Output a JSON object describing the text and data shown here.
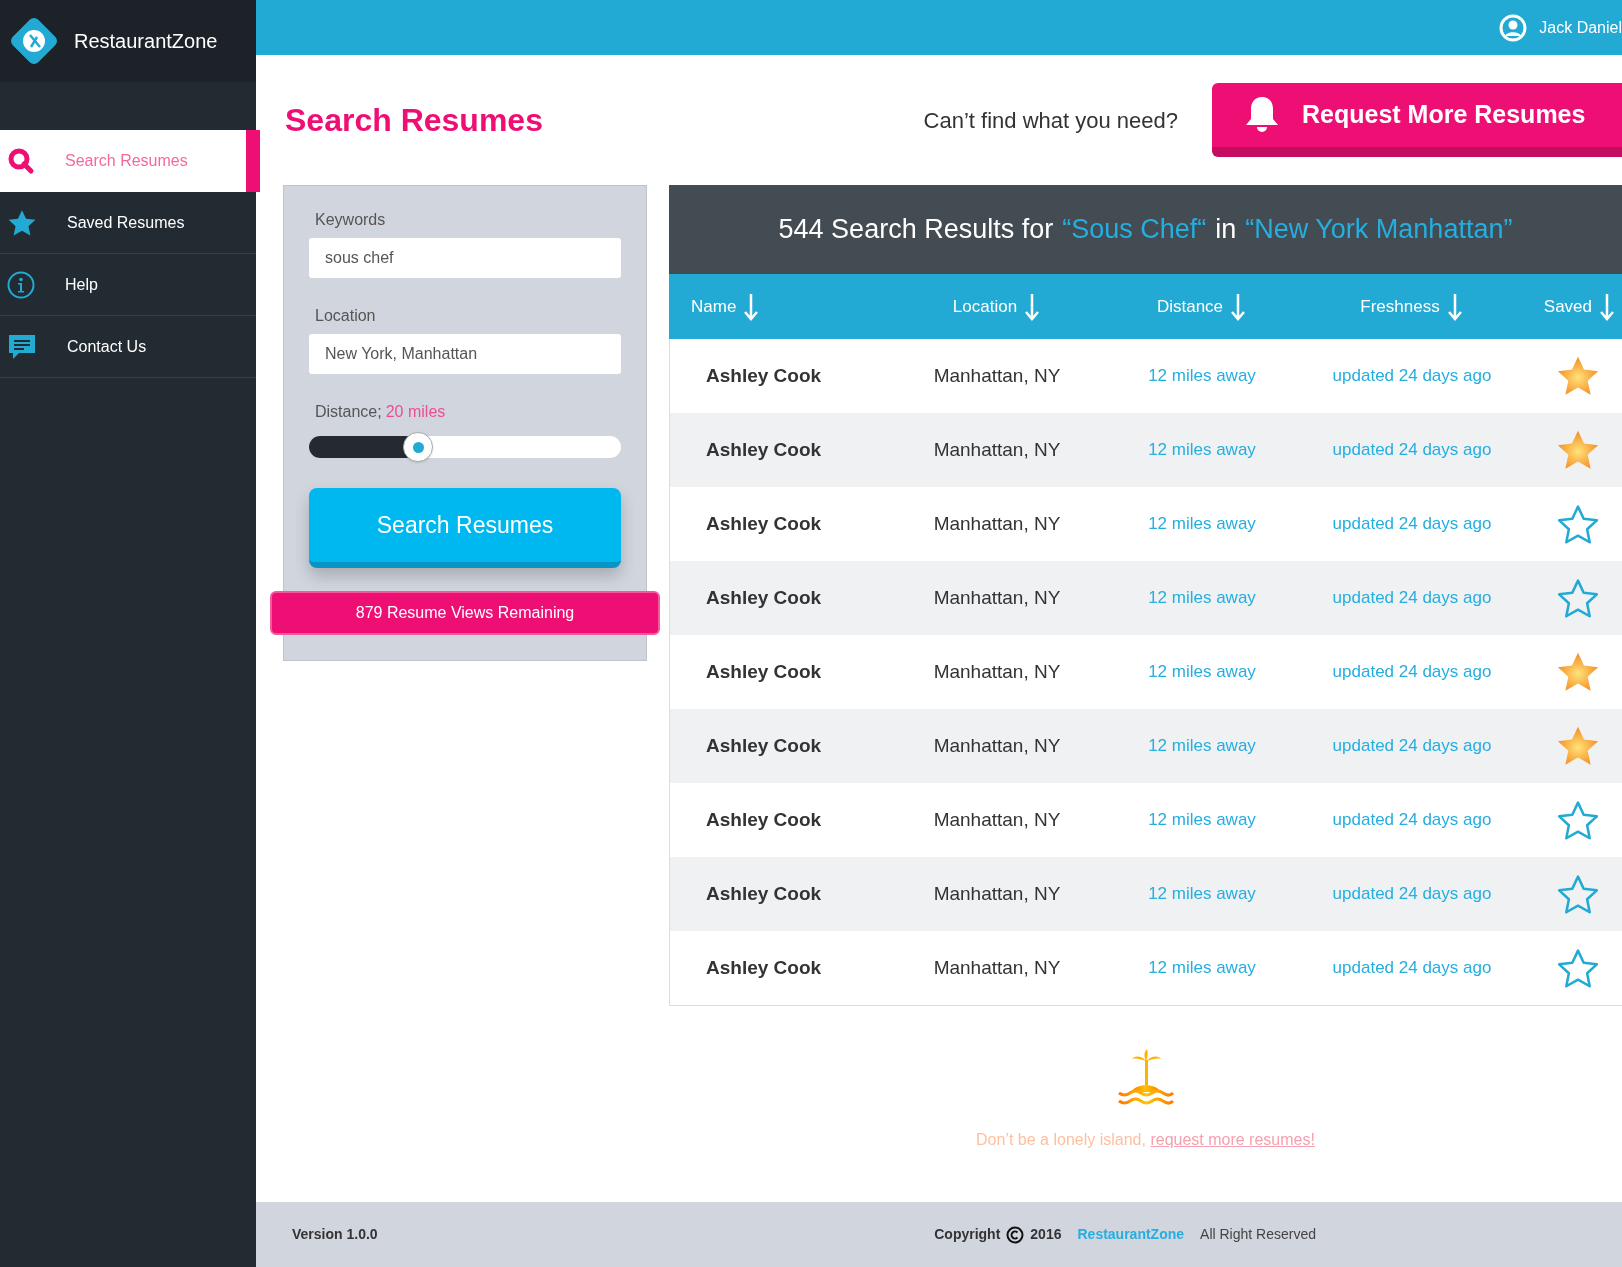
{
  "brand": {
    "name": "RestaurantZone"
  },
  "topbar": {
    "user_name": "Jack Daniel"
  },
  "sidebar": {
    "items": [
      {
        "label": "Search Resumes",
        "kind": "search",
        "selected": true
      },
      {
        "label": "Saved Resumes",
        "kind": "star",
        "selected": false
      },
      {
        "label": "Help",
        "kind": "info",
        "selected": false
      },
      {
        "label": "Contact Us",
        "kind": "chat",
        "selected": false
      }
    ]
  },
  "page_title": "Search Resumes",
  "request_prompt": "Can’t find what you need?",
  "request_button": "Request More Resumes",
  "filters": {
    "keywords_label": "Keywords",
    "keywords_value": "sous chef",
    "location_label": "Location",
    "location_value": "New York, Manhattan",
    "distance_label": "Distance;",
    "distance_value": "20 miles",
    "distance_slider": {
      "level": 0.35
    },
    "search_button": "Search Resumes",
    "views_remaining": "879 Resume Views Remaining"
  },
  "results": {
    "count_text": "544 Search Results for",
    "query": "“Sous Chef“",
    "connector": "in",
    "location": "“New York Manhattan”",
    "columns": [
      "Name",
      "Location",
      "Distance",
      "Freshness",
      "Saved"
    ],
    "rows": [
      {
        "name": "Ashley Cook",
        "location": "Manhattan, NY",
        "distance": "12 miles away",
        "freshness": "updated 24 days ago",
        "saved": true
      },
      {
        "name": "Ashley Cook",
        "location": "Manhattan, NY",
        "distance": "12 miles away",
        "freshness": "updated 24 days ago",
        "saved": true
      },
      {
        "name": "Ashley Cook",
        "location": "Manhattan, NY",
        "distance": "12 miles away",
        "freshness": "updated 24 days ago",
        "saved": false
      },
      {
        "name": "Ashley Cook",
        "location": "Manhattan, NY",
        "distance": "12 miles away",
        "freshness": "updated 24 days ago",
        "saved": false
      },
      {
        "name": "Ashley Cook",
        "location": "Manhattan, NY",
        "distance": "12 miles away",
        "freshness": "updated 24 days ago",
        "saved": true
      },
      {
        "name": "Ashley Cook",
        "location": "Manhattan, NY",
        "distance": "12 miles away",
        "freshness": "updated 24 days ago",
        "saved": true
      },
      {
        "name": "Ashley Cook",
        "location": "Manhattan, NY",
        "distance": "12 miles away",
        "freshness": "updated 24 days ago",
        "saved": false
      },
      {
        "name": "Ashley Cook",
        "location": "Manhattan, NY",
        "distance": "12 miles away",
        "freshness": "updated 24 days ago",
        "saved": false
      },
      {
        "name": "Ashley Cook",
        "location": "Manhattan, NY",
        "distance": "12 miles away",
        "freshness": "updated 24 days ago",
        "saved": false
      }
    ]
  },
  "empty_message": {
    "text": "Don’t be a lonely island,",
    "link": "request more resumes!"
  },
  "footer": {
    "version": "Version 1.0.0",
    "copyright": "Copyright",
    "year": "2016",
    "brand": "RestaurantZone",
    "rights": "All Right Reserved"
  }
}
